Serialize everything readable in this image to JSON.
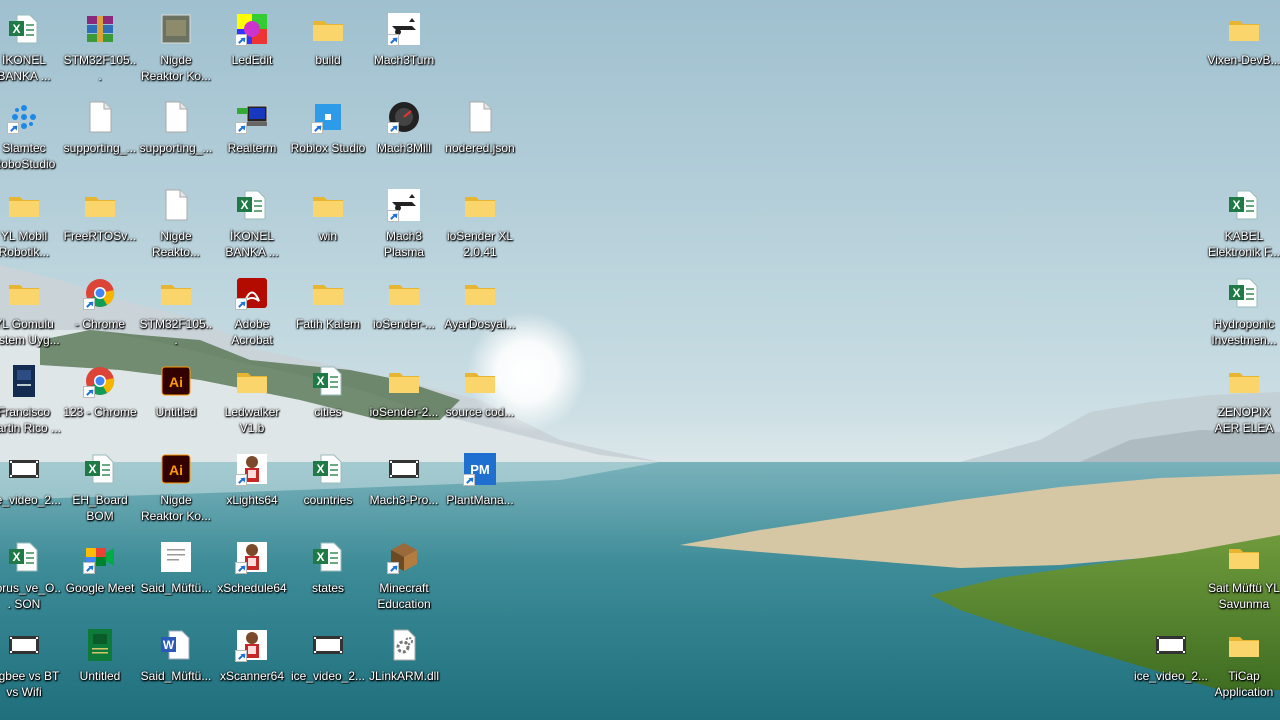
{
  "desktop": {
    "icons": [
      {
        "label": "İKONEL BANKA ...",
        "type": "excel",
        "col": 0,
        "row": 0,
        "sc": false
      },
      {
        "label": "STM32F105...",
        "type": "winrar",
        "col": 1,
        "row": 0,
        "sc": false
      },
      {
        "label": "Nigde Reaktor Ko...",
        "type": "photo",
        "col": 2,
        "row": 0,
        "sc": false
      },
      {
        "label": "LedEdit",
        "type": "ledit",
        "col": 3,
        "row": 0,
        "sc": true
      },
      {
        "label": "build",
        "type": "folder",
        "col": 4,
        "row": 0,
        "sc": false
      },
      {
        "label": "Mach3Turn",
        "type": "mach",
        "col": 5,
        "row": 0,
        "sc": true
      },
      {
        "label": "Slamtec RoboStudio",
        "type": "slamtec",
        "col": 0,
        "row": 1,
        "sc": true
      },
      {
        "label": "supporting_...",
        "type": "file",
        "col": 1,
        "row": 1,
        "sc": false
      },
      {
        "label": "supporting_...",
        "type": "file",
        "col": 2,
        "row": 1,
        "sc": false
      },
      {
        "label": "Realterm",
        "type": "realterm",
        "col": 3,
        "row": 1,
        "sc": true
      },
      {
        "label": "Roblox Studio",
        "type": "roblox",
        "col": 4,
        "row": 1,
        "sc": true
      },
      {
        "label": "Mach3Mill",
        "type": "machmill",
        "col": 5,
        "row": 1,
        "sc": true
      },
      {
        "label": "nodered.json",
        "type": "file",
        "col": 6,
        "row": 1,
        "sc": false
      },
      {
        "label": "YL Mobil Robotik...",
        "type": "folder",
        "col": 0,
        "row": 2,
        "sc": false
      },
      {
        "label": "FreeRTOSv...",
        "type": "folder",
        "col": 1,
        "row": 2,
        "sc": false
      },
      {
        "label": "Nigde Reakto...",
        "type": "file",
        "col": 2,
        "row": 2,
        "sc": false
      },
      {
        "label": "İKONEL BANKA ...",
        "type": "excel",
        "col": 3,
        "row": 2,
        "sc": false
      },
      {
        "label": "win",
        "type": "folder",
        "col": 4,
        "row": 2,
        "sc": false
      },
      {
        "label": "Mach3 Plasma",
        "type": "mach",
        "col": 5,
        "row": 2,
        "sc": true
      },
      {
        "label": "ioSender XL 2.0.41",
        "type": "folder",
        "col": 6,
        "row": 2,
        "sc": false
      },
      {
        "label": "YL Gomulu Sistem Uyg...",
        "type": "folder",
        "col": 0,
        "row": 3,
        "sc": false
      },
      {
        "label": "- Chrome",
        "type": "chrome",
        "col": 1,
        "row": 3,
        "sc": true
      },
      {
        "label": "STM32F105...",
        "type": "folder",
        "col": 2,
        "row": 3,
        "sc": false
      },
      {
        "label": "Adobe Acrobat",
        "type": "acrobat",
        "col": 3,
        "row": 3,
        "sc": true
      },
      {
        "label": "Fatih Kalem",
        "type": "folder",
        "col": 4,
        "row": 3,
        "sc": false
      },
      {
        "label": "ioSender-...",
        "type": "folder",
        "col": 5,
        "row": 3,
        "sc": false
      },
      {
        "label": "AyarDosyal...",
        "type": "folder",
        "col": 6,
        "row": 3,
        "sc": false
      },
      {
        "label": "Francisco Martin Rico ...",
        "type": "book",
        "col": 0,
        "row": 4,
        "sc": false
      },
      {
        "label": "123 - Chrome",
        "type": "chrome",
        "col": 1,
        "row": 4,
        "sc": true
      },
      {
        "label": "Untitled",
        "type": "ai",
        "col": 2,
        "row": 4,
        "sc": false
      },
      {
        "label": "Ledwalker V1.b",
        "type": "folder",
        "col": 3,
        "row": 4,
        "sc": false
      },
      {
        "label": "cities",
        "type": "excel",
        "col": 4,
        "row": 4,
        "sc": false
      },
      {
        "label": "ioSender-2...",
        "type": "folder",
        "col": 5,
        "row": 4,
        "sc": false
      },
      {
        "label": "source cod...",
        "type": "folder",
        "col": 6,
        "row": 4,
        "sc": false
      },
      {
        "label": "ice_video_2...",
        "type": "video",
        "col": 0,
        "row": 5,
        "sc": false
      },
      {
        "label": "EH_Board BOM",
        "type": "excel",
        "col": 1,
        "row": 5,
        "sc": false
      },
      {
        "label": "Nigde Reaktor Ko...",
        "type": "ai",
        "col": 2,
        "row": 5,
        "sc": false
      },
      {
        "label": "xLights64",
        "type": "xlights",
        "col": 3,
        "row": 5,
        "sc": true
      },
      {
        "label": "countries",
        "type": "excel",
        "col": 4,
        "row": 5,
        "sc": false
      },
      {
        "label": "Mach3-Pro...",
        "type": "video",
        "col": 5,
        "row": 5,
        "sc": false
      },
      {
        "label": "PlantMana...",
        "type": "pm",
        "col": 6,
        "row": 5,
        "sc": true
      },
      {
        "label": "Corus_ve_O... SON",
        "type": "excel",
        "col": 0,
        "row": 6,
        "sc": false
      },
      {
        "label": "Google Meet",
        "type": "meet",
        "col": 1,
        "row": 6,
        "sc": true
      },
      {
        "label": "Said_Müftü...",
        "type": "doc",
        "col": 2,
        "row": 6,
        "sc": false
      },
      {
        "label": "xSchedule64",
        "type": "xlights",
        "col": 3,
        "row": 6,
        "sc": true
      },
      {
        "label": "states",
        "type": "excel",
        "col": 4,
        "row": 6,
        "sc": false
      },
      {
        "label": "Minecraft Education",
        "type": "minecraft",
        "col": 5,
        "row": 6,
        "sc": true
      },
      {
        "label": "Zigbee vs BT vs Wifi",
        "type": "video",
        "col": 0,
        "row": 7,
        "sc": false
      },
      {
        "label": "Untitled",
        "type": "pcb",
        "col": 1,
        "row": 7,
        "sc": false
      },
      {
        "label": "Said_Müftü...",
        "type": "word",
        "col": 2,
        "row": 7,
        "sc": false
      },
      {
        "label": "xScanner64",
        "type": "xlights",
        "col": 3,
        "row": 7,
        "sc": true
      },
      {
        "label": "ice_video_2...",
        "type": "video",
        "col": 4,
        "row": 7,
        "sc": false
      },
      {
        "label": "JLinkARM.dll",
        "type": "dll",
        "col": 5,
        "row": 7,
        "sc": false
      },
      {
        "label": "Vixen-DevB...",
        "type": "folder",
        "col": "R",
        "row": 0,
        "sc": false
      },
      {
        "label": "KABEL Elektronik F...",
        "type": "excel",
        "col": "R",
        "row": 2,
        "sc": false
      },
      {
        "label": "Hydroponic Investmen...",
        "type": "excel",
        "col": "R",
        "row": 3,
        "sc": false
      },
      {
        "label": "ZENOPIX AER ELEA KUTU ...",
        "type": "folder",
        "col": "R",
        "row": 4,
        "sc": false
      },
      {
        "label": "Sait Müftü YL Savunma Ju...",
        "type": "folder",
        "col": "R",
        "row": 6,
        "sc": false
      },
      {
        "label": "TiCap Application",
        "type": "folder",
        "col": "R",
        "row": 7,
        "sc": false
      },
      {
        "label": "ice_video_2...",
        "type": "video",
        "col": "R2",
        "row": 7,
        "sc": false
      }
    ]
  }
}
